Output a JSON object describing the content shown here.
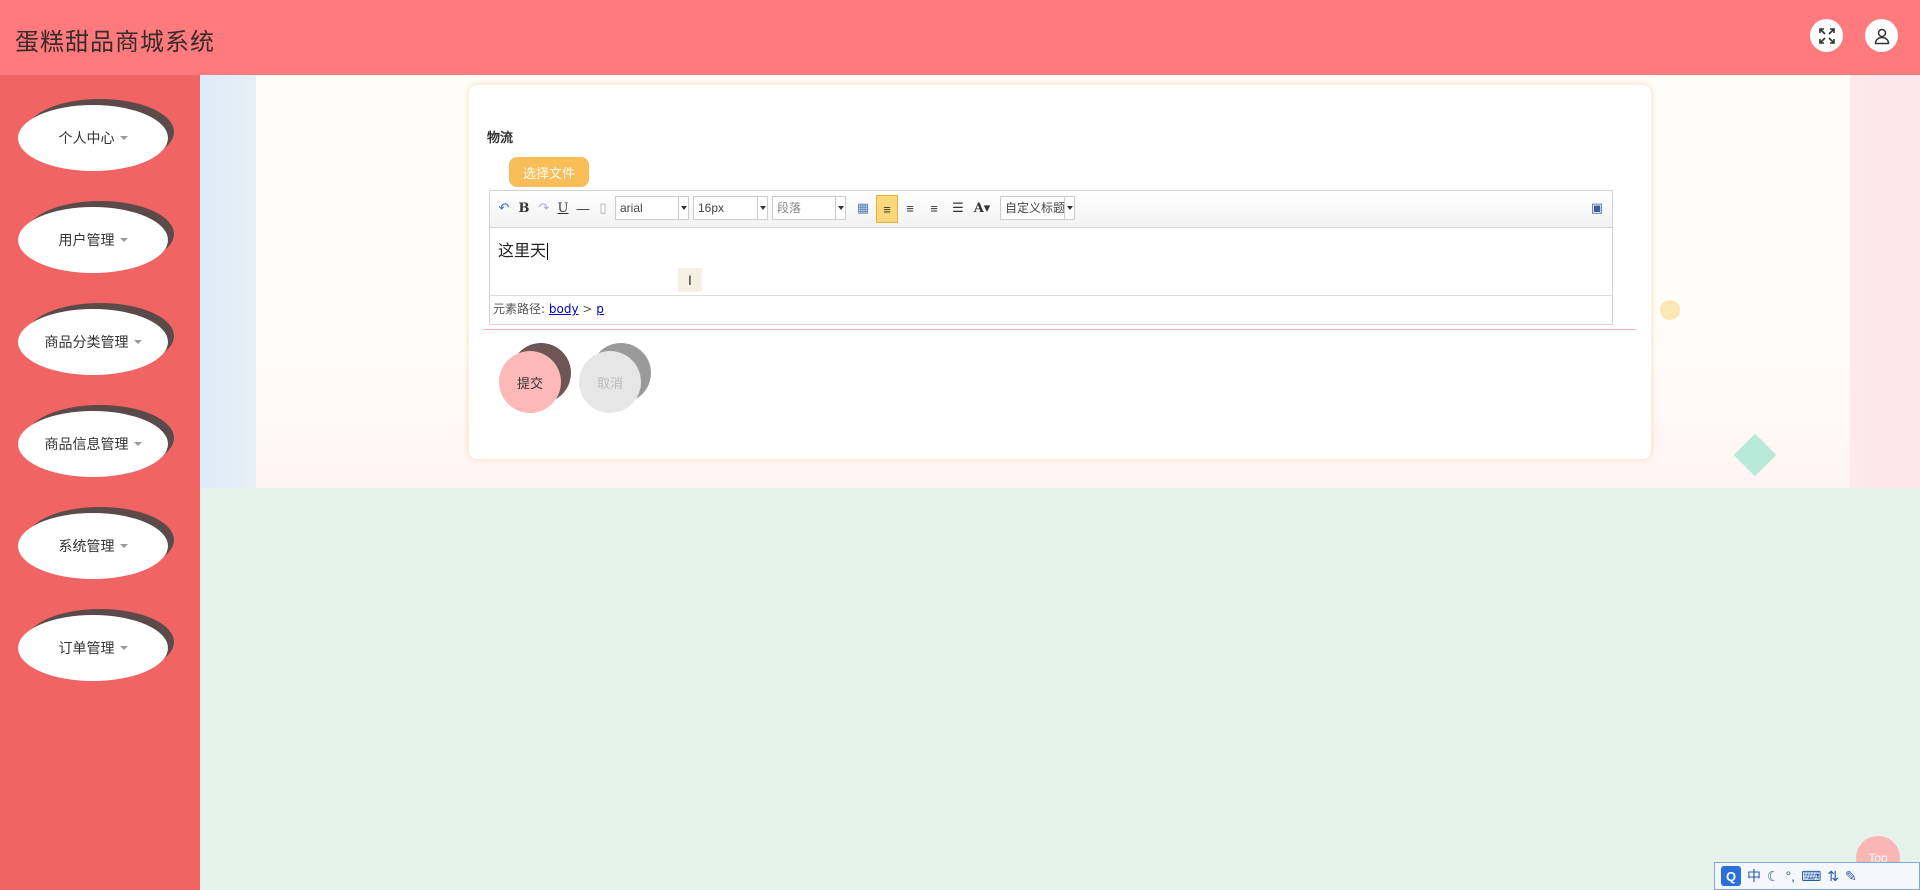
{
  "app": {
    "title": "蛋糕甜品商城系统"
  },
  "header": {
    "fullscreen_icon": "expand-icon",
    "user_icon": "user-icon"
  },
  "sidebar": {
    "items": [
      {
        "label": "个人中心"
      },
      {
        "label": "用户管理"
      },
      {
        "label": "商品分类管理"
      },
      {
        "label": "商品信息管理"
      },
      {
        "label": "系统管理"
      },
      {
        "label": "订单管理"
      }
    ]
  },
  "form": {
    "field_label": "物流",
    "file_button": "选择文件",
    "editor": {
      "font_family": "arial",
      "font_size": "16px",
      "paragraph": "段落",
      "custom_title": "自定义标题",
      "content": "这里天",
      "path_label": "元素路径:",
      "path_body": "body",
      "path_sep": ">",
      "path_p": "p"
    },
    "submit_label": "提交",
    "cancel_label": "取消"
  },
  "misc": {
    "top_label": "Top",
    "ime": {
      "q": "Q",
      "lang": "中",
      "moon": "☾",
      "punct": "°,",
      "keyboard": "⌨",
      "width": "⇅",
      "tool": "✎"
    }
  },
  "colors": {
    "header": "#fe7a7d",
    "sidebar": "#f06464",
    "file_button": "#f9bd58",
    "submit": "#fdb8b8",
    "cancel": "#e6e6e6"
  }
}
